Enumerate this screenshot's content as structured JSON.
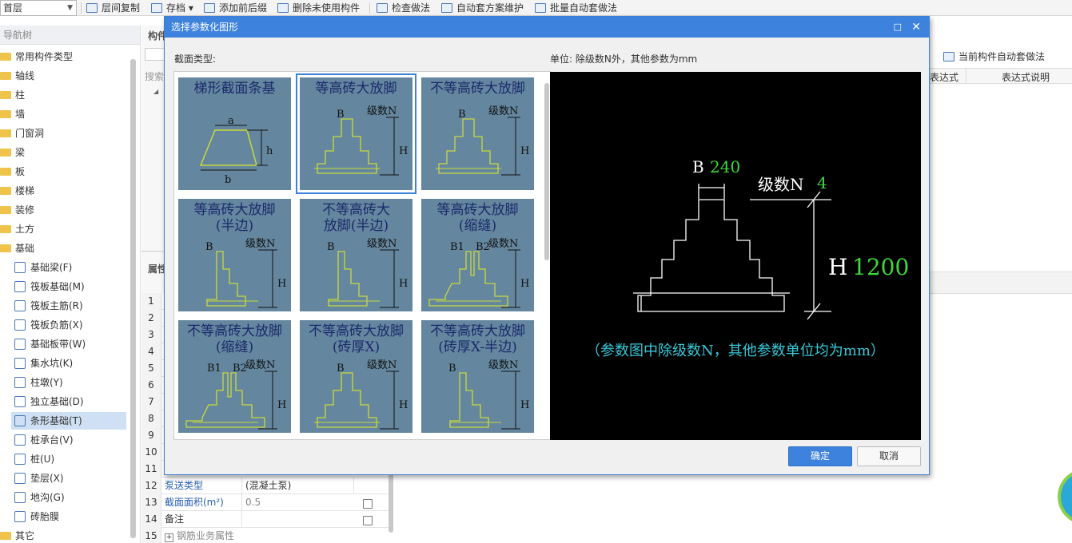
{
  "toolbar": {
    "floor": "首层",
    "items": [
      "层间复制",
      "存档",
      "添加前后缀",
      "删除未使用构件",
      "检查做法",
      "自动套方案维护",
      "批量自动套做法"
    ]
  },
  "nav": {
    "title": "导航树",
    "items": [
      "常用构件类型",
      "轴线",
      "柱",
      "墙",
      "门窗洞",
      "梁",
      "板",
      "楼梯",
      "装修",
      "土方",
      "基础"
    ],
    "sub_items": [
      "基础梁(F)",
      "筏板基础(M)",
      "筏板主筋(R)",
      "筏板负筋(X)",
      "基础板带(W)",
      "集水坑(K)",
      "柱墩(Y)",
      "独立基础(D)",
      "条形基础(T)",
      "桩承台(V)",
      "桩(U)",
      "垫层(X)",
      "地沟(G)",
      "砖胎膜"
    ],
    "other": "其它"
  },
  "mid": {
    "head1": "构件",
    "search": "搜索",
    "head2": "属性",
    "rows": [
      {
        "n": "1"
      },
      {
        "n": "2"
      },
      {
        "n": "3"
      },
      {
        "n": "4"
      },
      {
        "n": "5"
      },
      {
        "n": "6"
      },
      {
        "n": "7"
      },
      {
        "n": "8"
      },
      {
        "n": "9"
      },
      {
        "n": "10"
      },
      {
        "n": "11"
      },
      {
        "n": "12",
        "name": "泵送类型",
        "val": "(混凝土泵)"
      },
      {
        "n": "13",
        "name": "截面面积(m²)",
        "val": "0.5"
      },
      {
        "n": "14",
        "name": "备注",
        "val": ""
      },
      {
        "n": "15",
        "name": "钢筋业务属性",
        "val": ""
      }
    ]
  },
  "right": {
    "btn": "当前构件自动套做法",
    "col1": "表达式",
    "col2": "表达式说明"
  },
  "dialog": {
    "title": "选择参数化图形",
    "section_label": "截面类型:",
    "unit_label": "单位:  除级数N外，其他参数为mm",
    "cards": [
      "梯形截面条基",
      "等高砖大放脚",
      "不等高砖大放脚",
      "等高砖大放脚\n(半边)",
      "不等高砖大\n放脚(半边)",
      "等高砖大放脚\n(缩缝)",
      "不等高砖大放脚\n(缩缝)",
      "不等高砖大放脚\n(砖厚X)",
      "不等高砖大放脚\n(砖厚X-半边)"
    ],
    "card_labels": {
      "b": "B",
      "b1": "B1",
      "b2": "B2",
      "n": "级数N",
      "h": "H",
      "a": "a",
      "bb": "b",
      "hh": "h"
    },
    "preview": {
      "b_label": "B",
      "b_value": "240",
      "n_label": "级数N",
      "n_value": "4",
      "h_label": "H",
      "h_value": "1200",
      "note": "（参数图中除级数N，其他参数单位均为mm）"
    },
    "ok": "确定",
    "cancel": "取消"
  }
}
